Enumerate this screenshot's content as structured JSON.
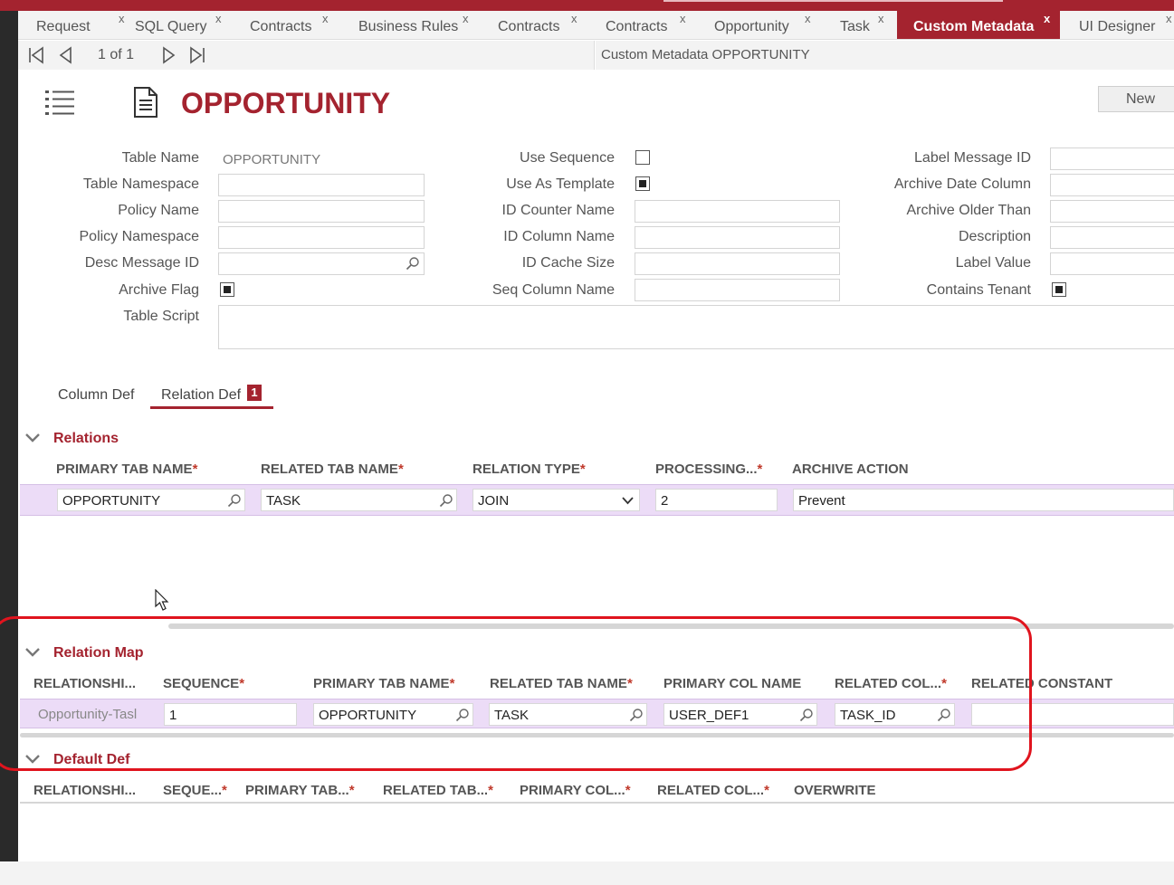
{
  "tabs": [
    {
      "label": "Request",
      "active": false
    },
    {
      "label": "SQL Query",
      "active": false
    },
    {
      "label": "Contracts",
      "active": false
    },
    {
      "label": "Business Rules",
      "active": false
    },
    {
      "label": "Contracts",
      "active": false
    },
    {
      "label": "Contracts",
      "active": false
    },
    {
      "label": "Opportunity",
      "active": false
    },
    {
      "label": "Task",
      "active": false
    },
    {
      "label": "Custom Metadata",
      "active": true
    },
    {
      "label": "UI Designer",
      "active": false
    }
  ],
  "tab_close": "x",
  "pager": {
    "count": "1 of 1"
  },
  "breadcrumb": "Custom Metadata OPPORTUNITY",
  "page_title": "OPPORTUNITY",
  "new_button": "New",
  "form": {
    "table_name_label": "Table Name",
    "table_name_value": "OPPORTUNITY",
    "table_namespace_label": "Table Namespace",
    "policy_name_label": "Policy Name",
    "policy_namespace_label": "Policy Namespace",
    "desc_message_id_label": "Desc Message ID",
    "archive_flag_label": "Archive Flag",
    "archive_flag": true,
    "table_script_label": "Table Script",
    "use_sequence_label": "Use Sequence",
    "use_sequence": false,
    "use_as_template_label": "Use As Template",
    "use_as_template": true,
    "id_counter_name_label": "ID Counter Name",
    "id_column_name_label": "ID Column Name",
    "id_cache_size_label": "ID Cache Size",
    "seq_column_name_label": "Seq Column Name",
    "label_message_id_label": "Label Message ID",
    "archive_date_column_label": "Archive Date Column",
    "archive_older_than_label": "Archive Older Than",
    "description_label": "Description",
    "label_value_label": "Label Value",
    "contains_tenant_label": "Contains Tenant",
    "contains_tenant": true
  },
  "subtabs": {
    "column_def": "Column Def",
    "relation_def": "Relation Def",
    "relation_def_badge": "1"
  },
  "relations": {
    "title": "Relations",
    "headers": [
      "PRIMARY TAB NAME",
      "RELATED TAB NAME",
      "RELATION TYPE",
      "PROCESSING...",
      "ARCHIVE ACTION"
    ],
    "required_mark": "*",
    "row": {
      "primary_tab": "OPPORTUNITY",
      "related_tab": "TASK",
      "relation_type": "JOIN",
      "processing": "2",
      "archive_action": "Prevent"
    }
  },
  "relation_map": {
    "title": "Relation Map",
    "headers": [
      "RELATIONSHI...",
      "SEQUENCE",
      "PRIMARY TAB NAME",
      "RELATED TAB NAME",
      "PRIMARY COL NAME",
      "RELATED COL...",
      "RELATED CONSTANT"
    ],
    "row": {
      "relationship": "Opportunity-Tasl",
      "sequence": "1",
      "primary_tab": "OPPORTUNITY",
      "related_tab": "TASK",
      "primary_col": "USER_DEF1",
      "related_col": "TASK_ID",
      "related_constant": ""
    }
  },
  "default_def": {
    "title": "Default Def",
    "headers": [
      "RELATIONSHI...",
      "SEQUE...",
      "PRIMARY TAB...",
      "RELATED TAB...",
      "PRIMARY COL...",
      "RELATED COL...",
      "OVERWRITE"
    ]
  },
  "colors": {
    "brand": "#a4232f",
    "row_highlight": "#ecdcf7",
    "annotation": "#e0141e"
  }
}
